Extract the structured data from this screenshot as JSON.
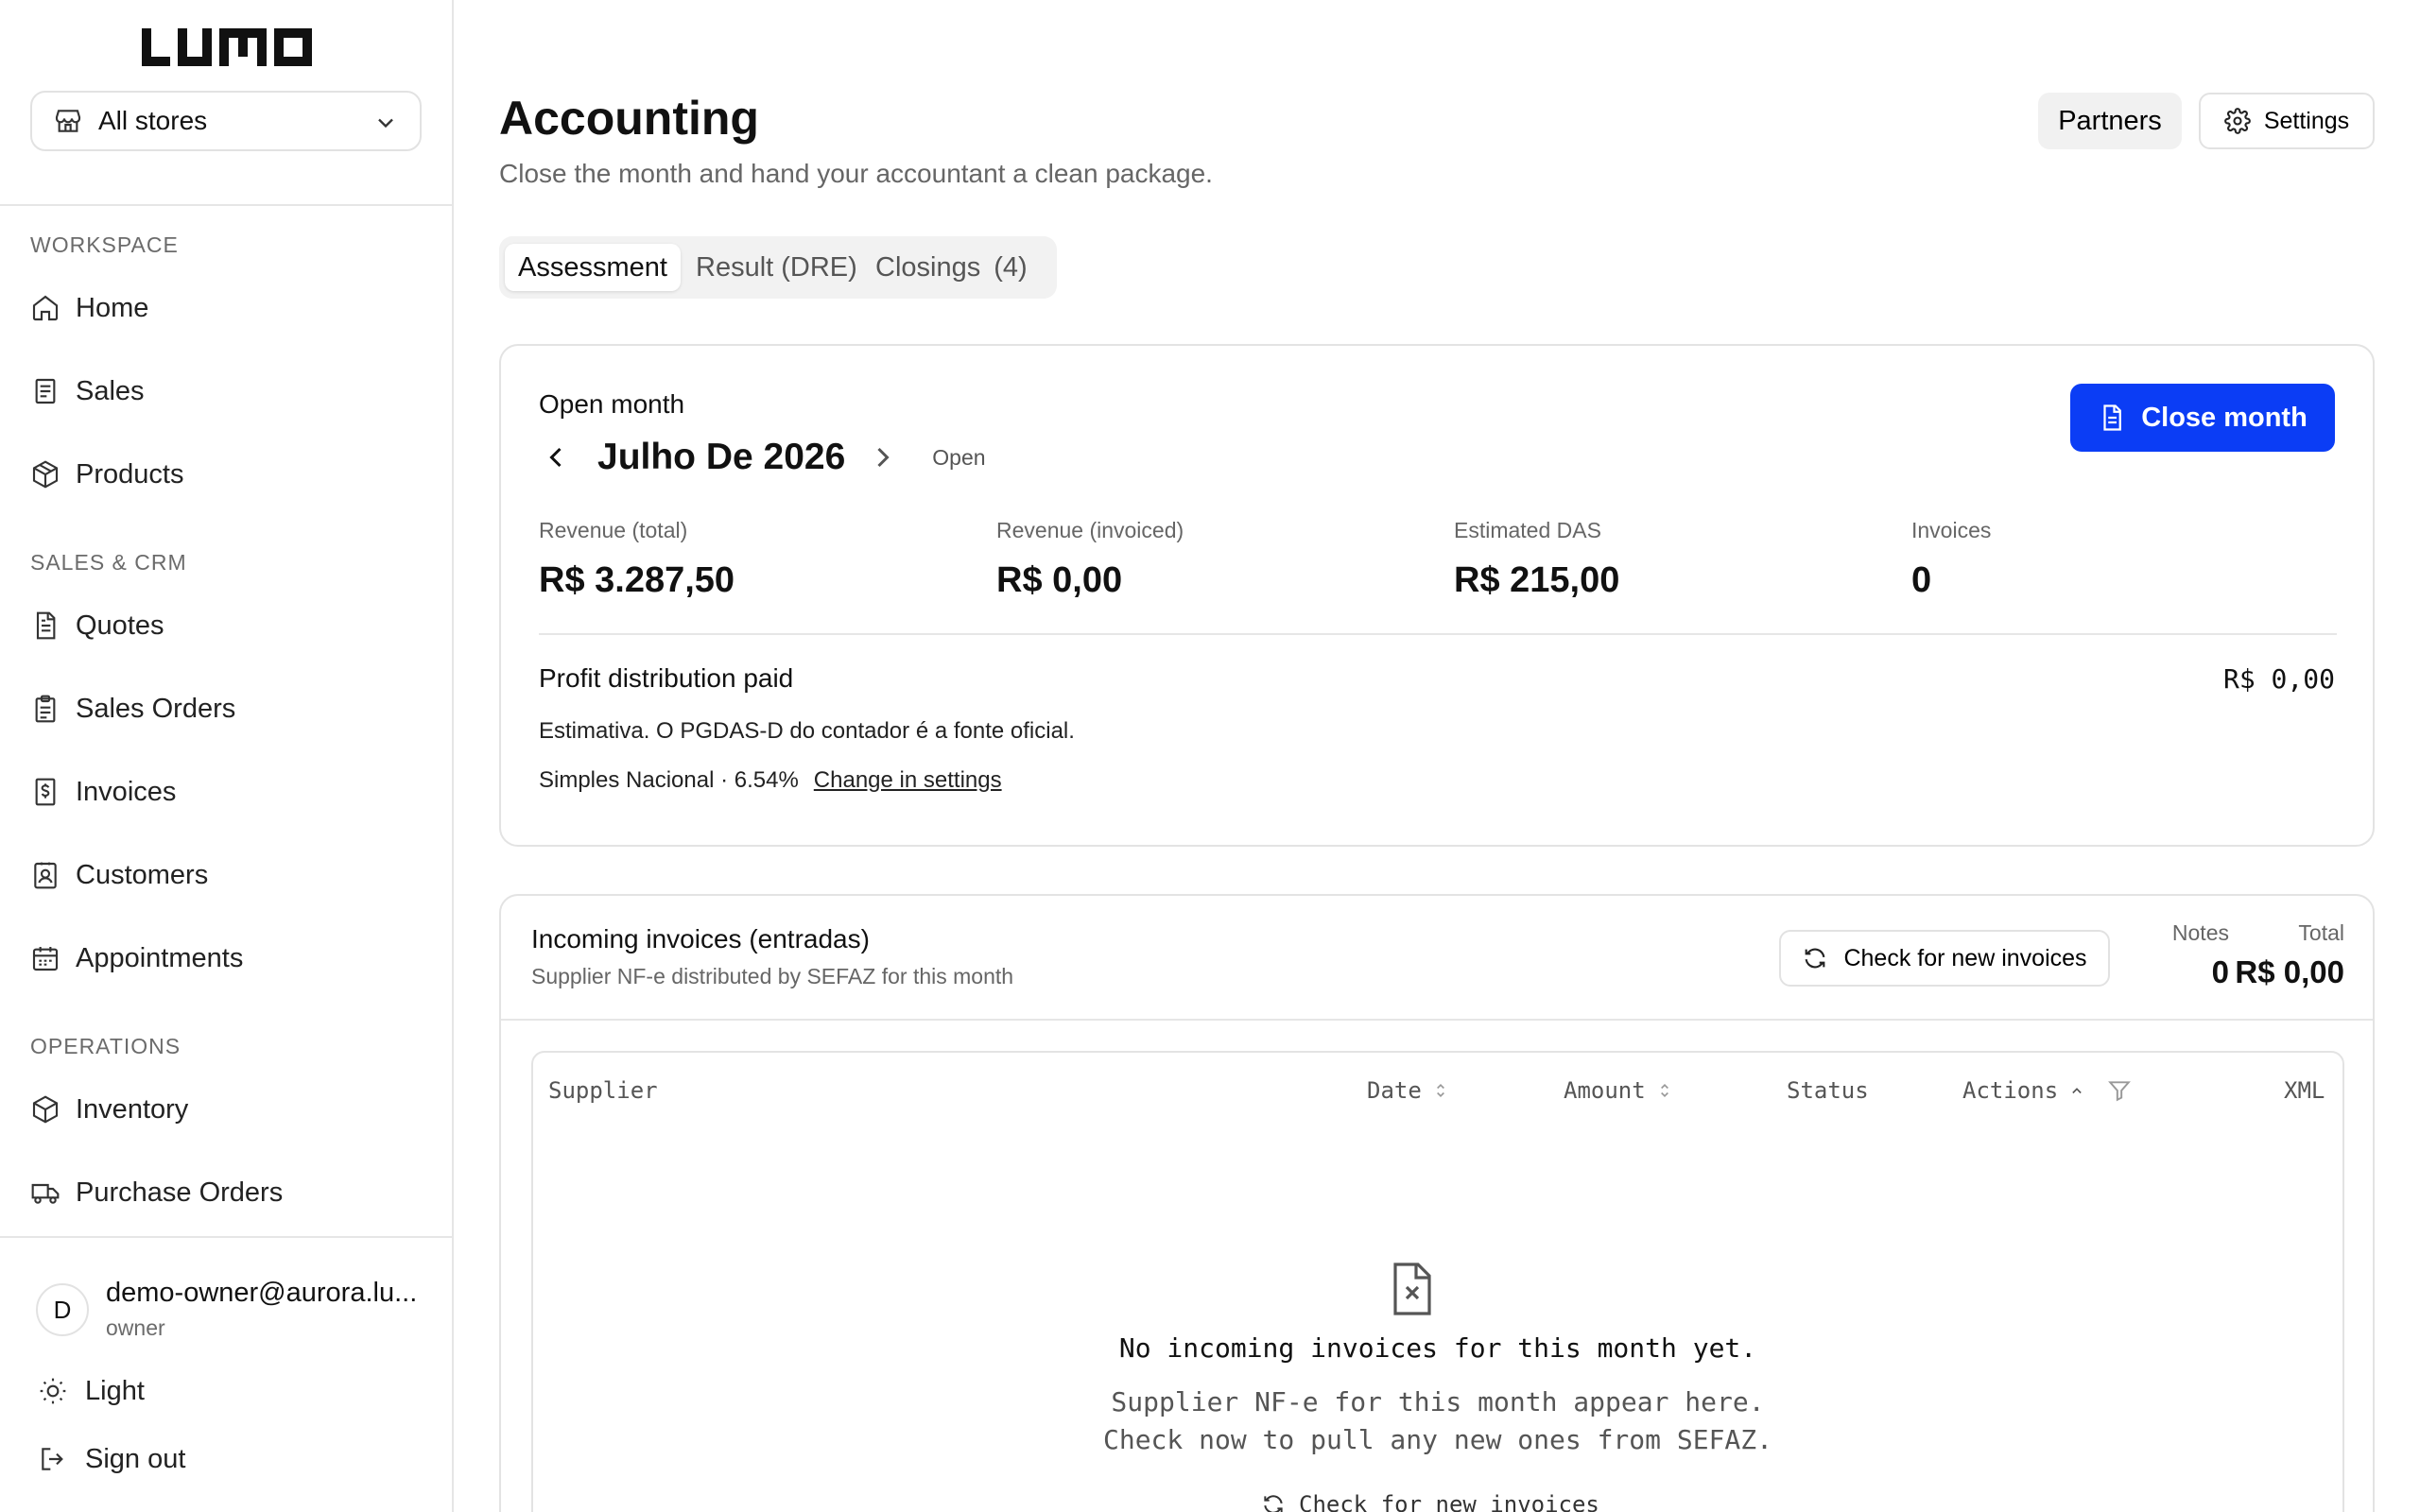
{
  "app": {
    "logo_text": "LUMO"
  },
  "store_selector": {
    "value": "All stores"
  },
  "sidebar": {
    "sections": [
      {
        "label": "WORKSPACE",
        "items": [
          {
            "label": "Home",
            "icon": "home-icon"
          },
          {
            "label": "Sales",
            "icon": "receipt-icon"
          },
          {
            "label": "Products",
            "icon": "box-icon"
          }
        ]
      },
      {
        "label": "SALES & CRM",
        "items": [
          {
            "label": "Quotes",
            "icon": "document-icon"
          },
          {
            "label": "Sales Orders",
            "icon": "clipboard-icon"
          },
          {
            "label": "Invoices",
            "icon": "dollar-receipt-icon"
          },
          {
            "label": "Customers",
            "icon": "contact-icon"
          },
          {
            "label": "Appointments",
            "icon": "calendar-icon"
          }
        ]
      },
      {
        "label": "OPERATIONS",
        "items": [
          {
            "label": "Inventory",
            "icon": "box-icon"
          },
          {
            "label": "Purchase Orders",
            "icon": "truck-icon"
          }
        ]
      }
    ],
    "user": {
      "initial": "D",
      "email": "demo-owner@aurora.lu...",
      "role": "owner"
    },
    "theme_label": "Light",
    "signout_label": "Sign out"
  },
  "header": {
    "title": "Accounting",
    "subtitle": "Close the month and hand your accountant a clean package.",
    "partners_label": "Partners",
    "settings_label": "Settings"
  },
  "tabs": [
    {
      "label": "Assessment",
      "active": true
    },
    {
      "label": "Result (DRE)",
      "active": false
    },
    {
      "label": "Closings",
      "active": false,
      "count": "(4)"
    }
  ],
  "month_card": {
    "label": "Open month",
    "month": "Julho De 2026",
    "status": "Open",
    "close_button": "Close month",
    "metrics": [
      {
        "label": "Revenue (total)",
        "value": "R$ 3.287,50"
      },
      {
        "label": "Revenue (invoiced)",
        "value": "R$ 0,00"
      },
      {
        "label": "Estimated DAS",
        "value": "R$ 215,00"
      },
      {
        "label": "Invoices",
        "value": "0"
      }
    ],
    "profit_label": "Profit distribution paid",
    "profit_value": "R$ 0,00",
    "note": "Estimativa. O PGDAS-D do contador é a fonte oficial.",
    "regime": "Simples Nacional · 6.54%",
    "regime_link": "Change in settings"
  },
  "incoming": {
    "title": "Incoming invoices (entradas)",
    "subtitle": "Supplier NF-e distributed by SEFAZ for this month",
    "check_button": "Check for new invoices",
    "notes_label": "Notes",
    "notes_value": "0",
    "total_label": "Total",
    "total_value": "R$ 0,00",
    "columns": {
      "supplier": "Supplier",
      "date": "Date",
      "amount": "Amount",
      "status": "Status",
      "actions": "Actions",
      "xml": "XML"
    },
    "empty": {
      "title": "No incoming invoices for this month yet.",
      "line1": "Supplier NF-e for this month appear here.",
      "line2": "Check now to pull any new ones from SEFAZ.",
      "button": "Check for new invoices"
    }
  },
  "colors": {
    "accent": "#0b3df5",
    "border": "#e3e3e3",
    "muted_text": "#666666"
  }
}
